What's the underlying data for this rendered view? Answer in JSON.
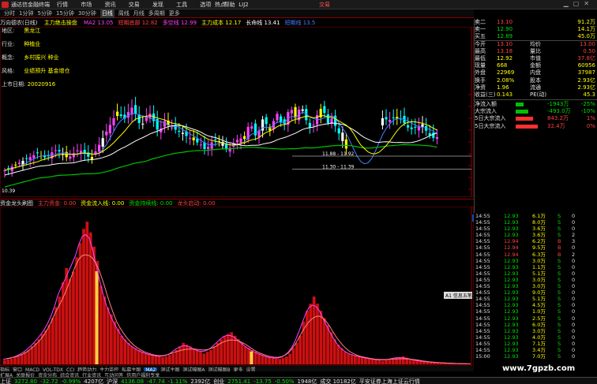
{
  "window": {
    "title": "通达信金融终端",
    "menus": [
      "行情",
      "市场",
      "资讯",
      "交易",
      "发现",
      "工具",
      "选项",
      "帮助"
    ],
    "extra_menu": [
      "热点",
      "LIJ2"
    ],
    "trade_button": "交易"
  },
  "periods": [
    "分时",
    "1分钟",
    "5分钟",
    "15分钟",
    "30分钟",
    "日线",
    "周线",
    "月线",
    "多周期",
    "更多"
  ],
  "selected_period": "日线",
  "stock": {
    "label": "万向德农(日线)",
    "indicator": "主力绝击操盘"
  },
  "legend1": [
    {
      "text": "MA2 13.05",
      "color": "#ff40ff"
    },
    {
      "text": "短期底部 12.82",
      "color": "#ff4040"
    },
    {
      "text": "多空线 12.99",
      "color": "#ff40ff"
    },
    {
      "text": "主力成本 12.17",
      "color": "#ffff00"
    },
    {
      "text": "长命线 13.41",
      "color": "#ffffff"
    },
    {
      "text": "短期线 13.5",
      "color": "#4080ff"
    }
  ],
  "info": [
    {
      "k": "地区:",
      "v": "黑龙江"
    },
    {
      "k": "行业:",
      "v": "种植业"
    },
    {
      "k": "概念:",
      "v": "乡村振兴 种业"
    },
    {
      "k": "风格:",
      "v": "业绩预升 基金增仓"
    },
    {
      "k": "上市日期:",
      "v": "20020916"
    }
  ],
  "price_axis": [
    "14.50",
    "14.00",
    "13.50",
    "13.00",
    "12.50",
    "12.00",
    "11.50",
    "11.00",
    "10.50"
  ],
  "annotations": [
    "11.88 - 11.92",
    "11.30 - 11.39"
  ],
  "low_label": "10.39",
  "legend2": [
    {
      "text": "资金龙头刷图",
      "color": "#e0e0e0"
    },
    {
      "text": "主力资金: 0.00",
      "color": "#ff4040"
    },
    {
      "text": "资金流入线: 0.00",
      "color": "#ffff00"
    },
    {
      "text": "资金持续线: 0.00",
      "color": "#00e000"
    },
    {
      "text": "龙头启动: 0.00",
      "color": "#ff4040"
    }
  ],
  "vol_axis": [
    "409.17",
    "300",
    "250",
    "200",
    "150",
    "100",
    "50"
  ],
  "date_axis": [
    "2021年",
    "12",
    "2022/01/26三",
    "3",
    "5",
    "6"
  ],
  "tooltip": "A1 信息五笔",
  "bottom_tabs": [
    "指标",
    "窗口",
    "MACD",
    "VOL-TDX",
    "CCI",
    "趋势动力",
    "主力监控",
    "私募主图",
    "MA2",
    "测试主图",
    "测试幅图A",
    "测试幅图B",
    "更多",
    "设置"
  ],
  "bottom_tabs2": [
    "扩展A",
    "关联报价",
    "资金分布",
    "综合资讯",
    "行业资讯",
    "互动问答",
    "信用户福利专享"
  ],
  "quote": [
    {
      "k": "卖二",
      "p": "13.10",
      "v": "91.2万"
    },
    {
      "k": "卖一",
      "p": "12.90",
      "v": "14.1万"
    },
    {
      "k": "买五",
      "p": "12.89",
      "v": "45.0万"
    },
    {
      "k": "今开",
      "p": "13.10",
      "k2": "均价",
      "v": "13.00"
    },
    {
      "k": "最高",
      "p": "13.18",
      "k2": "量比",
      "v": "0.50"
    },
    {
      "k": "最低",
      "p": "12.92",
      "k2": "市值",
      "v": "37.8亿"
    },
    {
      "k": "现量",
      "p": "668",
      "k2": "金额",
      "v": "60956"
    },
    {
      "k": "外盘",
      "p": "22969",
      "k2": "内盘",
      "v": "37987"
    },
    {
      "k": "换手",
      "p": "2.08%",
      "k2": "股本",
      "v": "2.93亿"
    },
    {
      "k": "净资",
      "p": "1.96",
      "k2": "流通",
      "v": "2.93亿"
    },
    {
      "k": "收益(三)",
      "p": "0.143",
      "k2": "PE(动)",
      "v": "45.3"
    }
  ],
  "flows": [
    {
      "k": "净流入额",
      "v": "-1943万",
      "p": "-25%"
    },
    {
      "k": "大宗流入",
      "v": "-493.0万",
      "p": "-10%"
    },
    {
      "k": "5日大宗流入",
      "v": "843.2万",
      "p": "1%"
    },
    {
      "k": "5日大宗流入",
      "v": "32.4万",
      "p": "0%"
    }
  ],
  "ticks": [
    [
      "14:55",
      "12.93",
      "6.1万",
      "S",
      "0"
    ],
    [
      "14:55",
      "12.93",
      "8.0万",
      "S",
      "0"
    ],
    [
      "14:55",
      "12.93",
      "3.6万",
      "S",
      "0"
    ],
    [
      "14:55",
      "12.93",
      "3.6万",
      "S",
      "2"
    ],
    [
      "14:55",
      "12.94",
      "6.2万",
      "B",
      "3"
    ],
    [
      "14:55",
      "12.94",
      "9.5万",
      "B",
      "0"
    ],
    [
      "14:55",
      "12.94",
      "6.3万",
      "B",
      "2"
    ],
    [
      "14:55",
      "12.93",
      "3.0万",
      "S",
      "0"
    ],
    [
      "14:55",
      "12.93",
      "1.1万",
      "S",
      "0"
    ],
    [
      "14:55",
      "12.93",
      "5.1万",
      "S",
      "0"
    ],
    [
      "14:55",
      "12.93",
      "3.0万",
      "S",
      "0"
    ],
    [
      "14:55",
      "12.93",
      "3.0万",
      "S",
      "0"
    ],
    [
      "14:55",
      "12.93",
      "9.0万",
      "S",
      "0"
    ],
    [
      "14:55",
      "12.93",
      "5.1万",
      "S",
      "0"
    ],
    [
      "14:55",
      "12.93",
      "4.5万",
      "S",
      "0"
    ],
    [
      "14:55",
      "12.93",
      "1.0万",
      "S",
      "0"
    ],
    [
      "14:55",
      "12.93",
      "2.5万",
      "S",
      "0"
    ],
    [
      "14:55",
      "12.93",
      "6.0万",
      "S",
      "0"
    ],
    [
      "14:55",
      "12.93",
      "3.0万",
      "S",
      "0"
    ],
    [
      "14:55",
      "12.93",
      "4.0万",
      "S",
      "0"
    ],
    [
      "14:55",
      "12.93",
      "7.1万",
      "S",
      "0"
    ],
    [
      "14:55",
      "12.93",
      "3.4万",
      "S",
      "0"
    ],
    [
      "15:00",
      "12.93",
      "7.0万",
      "S",
      "0"
    ]
  ],
  "status": [
    {
      "text": "上证",
      "color": "#e0e0e0"
    },
    {
      "text": "3272.80",
      "color": "#00e000"
    },
    {
      "text": "-32.72",
      "color": "#00e000"
    },
    {
      "text": "-0.99%",
      "color": "#00e000"
    },
    {
      "text": "4207亿",
      "color": "#e0e0e0"
    },
    {
      "text": "沪深",
      "color": "#e0e0e0"
    },
    {
      "text": "4136.08",
      "color": "#00e000"
    },
    {
      "text": "-47.74",
      "color": "#00e000"
    },
    {
      "text": "-1.11%",
      "color": "#00e000"
    },
    {
      "text": "2392亿",
      "color": "#e0e0e0"
    },
    {
      "text": "创业",
      "color": "#e0e0e0"
    },
    {
      "text": "2751.41",
      "color": "#00e000"
    },
    {
      "text": "-13.75",
      "color": "#00e000"
    },
    {
      "text": "-0.50%",
      "color": "#00e000"
    },
    {
      "text": "1948亿",
      "color": "#e0e0e0"
    },
    {
      "text": "成交 10182亿",
      "color": "#e0e0e0"
    },
    {
      "text": "平安证券上海上证云行情",
      "color": "#e0e0e0"
    }
  ],
  "watermark": "www.7gpzb.com",
  "chart_data": {
    "type": "candlestick",
    "volume_bars": [
      12,
      14,
      16,
      20,
      22,
      28,
      34,
      40,
      50,
      60,
      70,
      85,
      96,
      110,
      130,
      160,
      190,
      230,
      270,
      240,
      260,
      300,
      340,
      380,
      400,
      370,
      330,
      290,
      220,
      190,
      160,
      140,
      120,
      100,
      80,
      70,
      60,
      50,
      45,
      40,
      35,
      30,
      28,
      26,
      24,
      22,
      20,
      22,
      26,
      30,
      40,
      50,
      60,
      55,
      50,
      45,
      40,
      35,
      30,
      35,
      40,
      50,
      60,
      70,
      80,
      85,
      90,
      80,
      70,
      60,
      50,
      45,
      40,
      35,
      30,
      25,
      22,
      20,
      18,
      16,
      15,
      18,
      22,
      30,
      45,
      60,
      80,
      120,
      150,
      170,
      190,
      170,
      150,
      130,
      110,
      90,
      70,
      55,
      45,
      35,
      30,
      28,
      25,
      22,
      20,
      18,
      16,
      15,
      14,
      12,
      10,
      12,
      14,
      16,
      18,
      20,
      22,
      18,
      15,
      12,
      10,
      9,
      8,
      7,
      6,
      5,
      5,
      4,
      4,
      3,
      3,
      2,
      2,
      2,
      1,
      1
    ],
    "candles": []
  }
}
